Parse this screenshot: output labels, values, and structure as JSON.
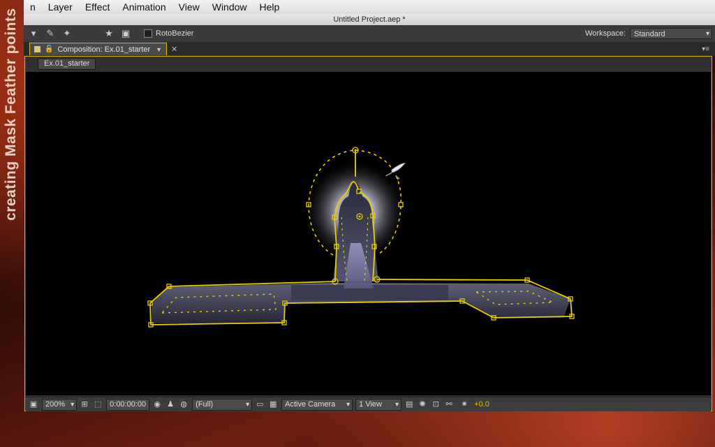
{
  "side_caption": "creating Mask Feather points",
  "menu": [
    "n",
    "Layer",
    "Effect",
    "Animation",
    "View",
    "Window",
    "Help"
  ],
  "window_title": "Untitled Project.aep *",
  "toolbar": {
    "rotobezier_label": "RotoBezier",
    "workspace_label": "Workspace:",
    "workspace_value": "Standard"
  },
  "panel": {
    "tab_title": "Composition: Ex.01_starter",
    "breadcrumb": "Ex.01_starter"
  },
  "viewer_bar": {
    "zoom": "200%",
    "timecode": "0:00:00:00",
    "resolution": "(Full)",
    "camera": "Active Camera",
    "views": "1 View",
    "exposure": "+0.0"
  },
  "colors": {
    "mask_path": "#e8d000",
    "accent": "#d9b400"
  }
}
